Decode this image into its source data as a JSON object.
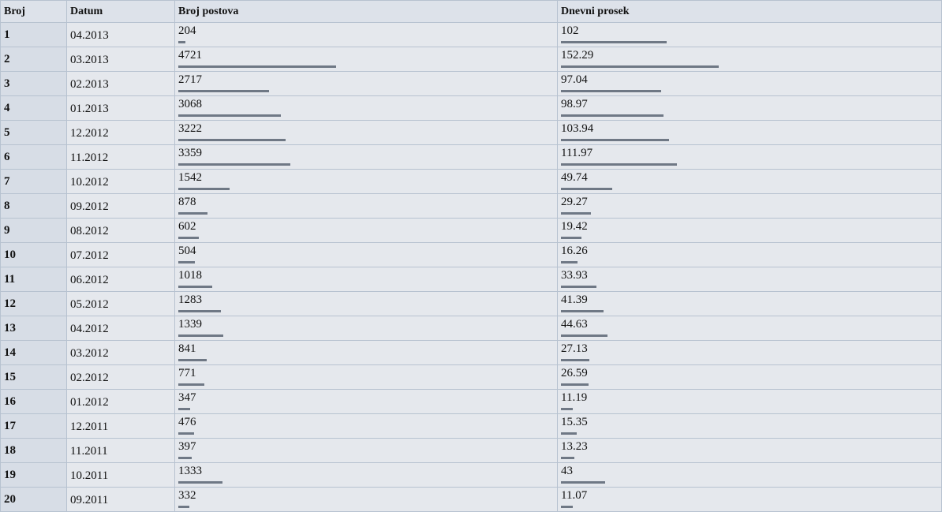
{
  "table": {
    "headers": {
      "rank": "Broj",
      "date": "Datum",
      "posts": "Broj postova",
      "avg": "Dnevni prosek"
    },
    "rows": [
      {
        "rank": "1",
        "date": "04.2013",
        "posts": "204",
        "avg": "102"
      },
      {
        "rank": "2",
        "date": "03.2013",
        "posts": "4721",
        "avg": "152.29"
      },
      {
        "rank": "3",
        "date": "02.2013",
        "posts": "2717",
        "avg": "97.04"
      },
      {
        "rank": "4",
        "date": "01.2013",
        "posts": "3068",
        "avg": "98.97"
      },
      {
        "rank": "5",
        "date": "12.2012",
        "posts": "3222",
        "avg": "103.94"
      },
      {
        "rank": "6",
        "date": "11.2012",
        "posts": "3359",
        "avg": "111.97"
      },
      {
        "rank": "7",
        "date": "10.2012",
        "posts": "1542",
        "avg": "49.74"
      },
      {
        "rank": "8",
        "date": "09.2012",
        "posts": "878",
        "avg": "29.27"
      },
      {
        "rank": "9",
        "date": "08.2012",
        "posts": "602",
        "avg": "19.42"
      },
      {
        "rank": "10",
        "date": "07.2012",
        "posts": "504",
        "avg": "16.26"
      },
      {
        "rank": "11",
        "date": "06.2012",
        "posts": "1018",
        "avg": "33.93"
      },
      {
        "rank": "12",
        "date": "05.2012",
        "posts": "1283",
        "avg": "41.39"
      },
      {
        "rank": "13",
        "date": "04.2012",
        "posts": "1339",
        "avg": "44.63"
      },
      {
        "rank": "14",
        "date": "03.2012",
        "posts": "841",
        "avg": "27.13"
      },
      {
        "rank": "15",
        "date": "02.2012",
        "posts": "771",
        "avg": "26.59"
      },
      {
        "rank": "16",
        "date": "01.2012",
        "posts": "347",
        "avg": "11.19"
      },
      {
        "rank": "17",
        "date": "12.2011",
        "posts": "476",
        "avg": "15.35"
      },
      {
        "rank": "18",
        "date": "11.2011",
        "posts": "397",
        "avg": "13.23"
      },
      {
        "rank": "19",
        "date": "10.2011",
        "posts": "1333",
        "avg": "43"
      },
      {
        "rank": "20",
        "date": "09.2011",
        "posts": "332",
        "avg": "11.07"
      }
    ]
  },
  "colors": {
    "header_bg": "#dde2ea",
    "cell_bg": "#e5e8ed",
    "rank_bg": "#d7dde6",
    "border": "#b7c2d0",
    "bar": "#6f7885"
  }
}
